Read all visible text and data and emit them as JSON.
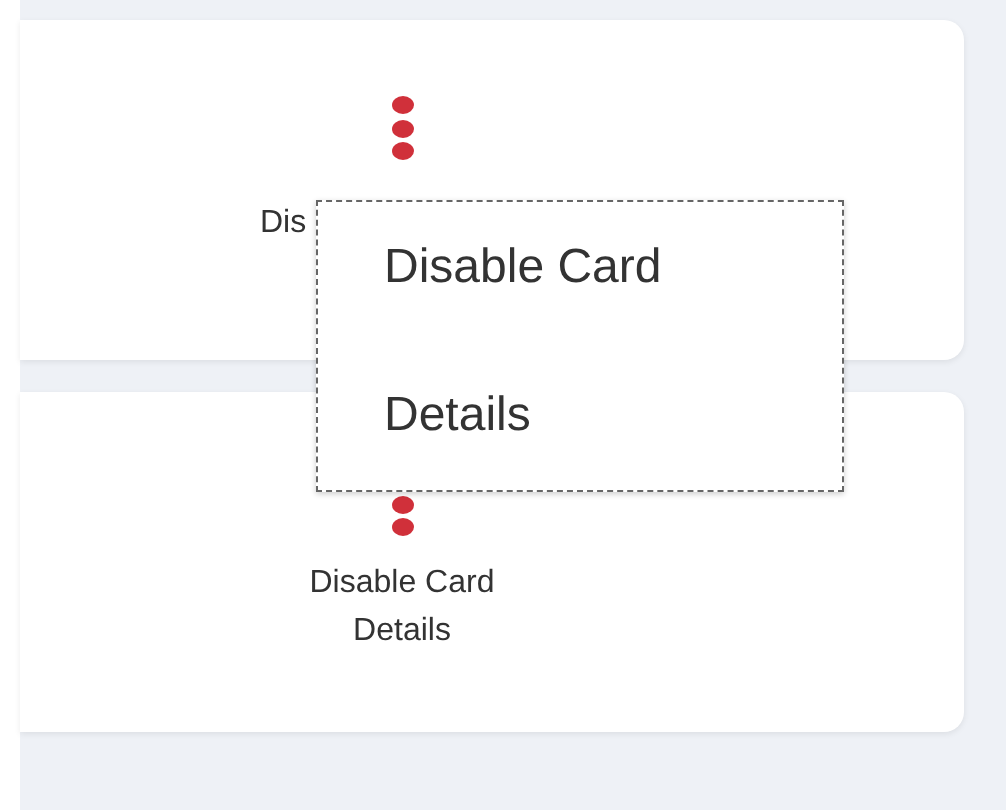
{
  "cards": [
    {
      "kind": "covered",
      "lines": [
        "Dis"
      ]
    },
    {
      "kind": "full",
      "lines": [
        "Disable Card",
        "Details"
      ]
    }
  ],
  "menu": {
    "items": [
      "Disable Card",
      "Details"
    ]
  }
}
